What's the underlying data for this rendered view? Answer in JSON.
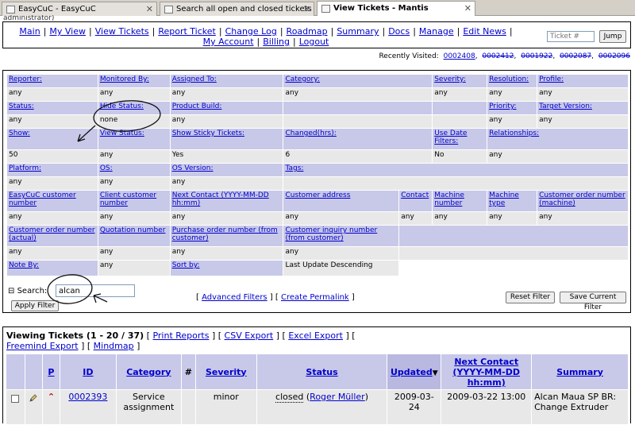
{
  "browser": {
    "tabs": [
      {
        "label": "EasyCuC - EasyCuC"
      },
      {
        "label": "Search all open and closed tickets w..."
      },
      {
        "label": "View Tickets - Mantis"
      }
    ],
    "top_clip": "administrator)"
  },
  "menu": {
    "items": [
      "Main",
      "My View",
      "View Tickets",
      "Report Ticket",
      "Change Log",
      "Roadmap",
      "Summary",
      "Docs",
      "Manage",
      "Edit News"
    ],
    "items2": [
      "My Account",
      "Billing",
      "Logout"
    ],
    "jump_placeholder": "Ticket #",
    "jump_label": "Jump"
  },
  "recent": {
    "label": "Recently Visited:",
    "ids": [
      "0002408",
      "0002412",
      "0001922",
      "0002087",
      "0002096"
    ]
  },
  "filters": {
    "r1": {
      "reporter": "Reporter:",
      "monitored": "Monitored By:",
      "assigned": "Assigned To:",
      "category": "Category:",
      "severity": "Severity:",
      "resolution": "Resolution:",
      "profile": "Profile:"
    },
    "v1": {
      "reporter": "any",
      "monitored": "any",
      "assigned": "any",
      "category": "any",
      "severity": "any",
      "resolution": "any",
      "profile": "any"
    },
    "r2": {
      "status": "Status:",
      "hide_status": "Hide Status:",
      "product_build": "Product Build:",
      "priority": "Priority:",
      "target_version": "Target Version:"
    },
    "v2": {
      "status": "any",
      "hide_status": "none",
      "product_build": "any",
      "priority": "any",
      "target_version": "any"
    },
    "r3": {
      "show": "Show:",
      "view_status": "View Status:",
      "sticky": "Show Sticky Tickets:",
      "changed": "Changed(hrs):",
      "use_date": "Use Date Filters:",
      "relationships": "Relationships:"
    },
    "v3": {
      "show": "50",
      "view_status": "any",
      "sticky": "Yes",
      "changed": "6",
      "use_date": "No",
      "relationships": "any"
    },
    "r4": {
      "platform": "Platform:",
      "os": "OS:",
      "os_version": "OS Version:",
      "tags": "Tags:"
    },
    "v4": {
      "platform": "any",
      "os": "any",
      "os_version": "any"
    },
    "r5": {
      "cust_number": "EasyCuC customer number",
      "client_number": "Client customer number",
      "next_contact": "Next Contact (YYYY-MM-DD hh:mm)",
      "cust_address": "Customer address",
      "contact": "Contact",
      "machine_number": "Machine number",
      "machine_type": "Machine type",
      "order_machine": "Customer order number (machine)"
    },
    "v5": {
      "cust_number": "any",
      "client_number": "any",
      "next_contact": "any",
      "cust_address": "any",
      "contact": "any",
      "machine_number": "any",
      "machine_type": "any",
      "order_machine": "any"
    },
    "r6": {
      "order_actual": "Customer order number (actual)",
      "quotation": "Quotation number",
      "purchase": "Purchase order number (from customer)",
      "inquiry": "Customer inquiry number (from customer)"
    },
    "v6": {
      "order_actual": "any",
      "quotation": "any",
      "purchase": "any",
      "inquiry": "any"
    },
    "r7": {
      "note_by": "Note By:",
      "note_by_value": "any",
      "sort_by": "Sort by:",
      "sort_value": "Last Update Descending"
    },
    "search_label": "Search:",
    "search_value": "alcan",
    "apply_label": "Apply Filter",
    "advanced_filters": "Advanced Filters",
    "create_permalink": "Create Permalink",
    "reset_label": "Reset Filter",
    "save_label": "Save Current Filter"
  },
  "viewing": {
    "title": "Viewing Tickets (1 - 20 / 37)",
    "print_reports": "Print Reports",
    "csv_export": "CSV Export",
    "excel_export": "Excel Export",
    "freemind_export": "Freemind Export",
    "mindmap": "Mindmap",
    "columns": {
      "p": "P",
      "id": "ID",
      "category": "Category",
      "hash": "#",
      "severity": "Severity",
      "status": "Status",
      "updated": "Updated",
      "next_contact": "Next Contact (YYYY-MM-DD hh:mm)",
      "summary": "Summary"
    },
    "row": {
      "id": "0002393",
      "category": "Service assignment",
      "severity": "minor",
      "status": "closed",
      "user": "Roger Müller",
      "updated": "2009-03-24",
      "next_contact": "2009-03-22 13:00",
      "summary": "Alcan Maua SP BR: Change Extruder"
    }
  },
  "colors": {
    "link": "#0000cc",
    "label_bg": "#c8c8e8",
    "value_bg": "#e8e8e8"
  }
}
